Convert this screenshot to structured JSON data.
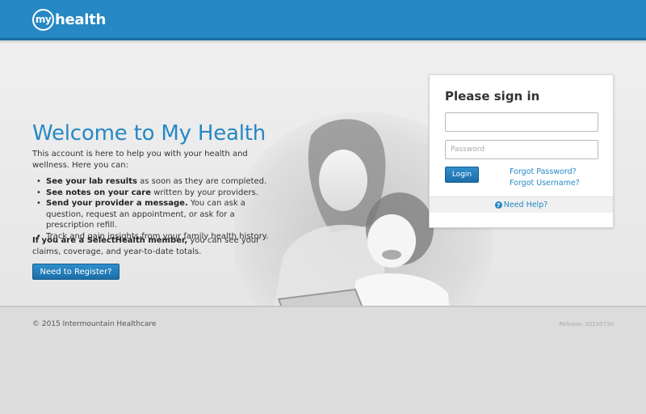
{
  "header": {
    "logo_mark": "my",
    "logo_word": "health"
  },
  "hero": {
    "title": "Welcome to My Health",
    "intro": "This account is here to help you with your health and wellness. Here you can:",
    "features": [
      {
        "bold": "See your lab results",
        "rest": " as soon as they are completed."
      },
      {
        "bold": "See notes on your care",
        "rest": " written by your providers."
      },
      {
        "bold": "Send your provider a message.",
        "rest": " You can ask a question, request an appointment, or ask for a prescription refill."
      },
      {
        "bold": "",
        "rest": "Track and gain insights from your family health history."
      }
    ],
    "member_bold": "If you are a SelectHealth member,",
    "member_rest": " you can see your claims, coverage, and year-to-date totals.",
    "register_label": "Need to Register?"
  },
  "signin": {
    "title": "Please sign in",
    "username_value": "",
    "password_placeholder": "Password",
    "login_label": "Login",
    "forgot_password": "Forgot Password?",
    "forgot_username": "Forgot Username?",
    "help_label": "Need Help?",
    "help_icon": "question-circle-icon"
  },
  "footer": {
    "copyright": "© 2015 Intermountain Healthcare",
    "release": "Release: 20150730"
  },
  "colors": {
    "brand_blue": "#2688c4",
    "header_border": "#1e6fa3",
    "button_dark": "#1c6ea6"
  }
}
